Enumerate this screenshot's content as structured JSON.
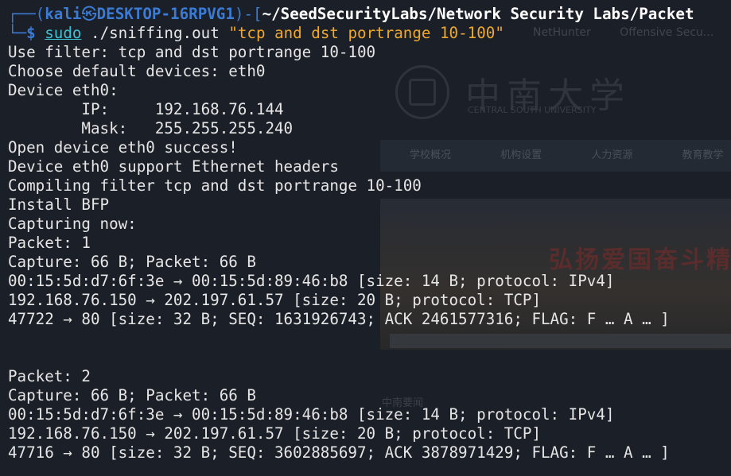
{
  "background": {
    "tabs": [
      "NetHunter",
      "Offensive Secu..."
    ],
    "site_title": "中南大学",
    "site_subtitle": "CENTRAL SOUTH UNIVERSITY",
    "nav": [
      "学校概况",
      "机构设置",
      "人力资源",
      "教育教学"
    ],
    "slogan": "弘扬爱国奋斗精",
    "news": "中南要闻"
  },
  "prompt": {
    "open": "┌──(",
    "user": "kali",
    "at": "㉿",
    "host": "DESKTOP-16RPVG1",
    "mid": ")-[",
    "path": "~/SeedSecurityLabs/Network Security Labs/Packet",
    "close": "",
    "tail": "└─",
    "dollar": "$",
    "sudo": "sudo",
    "exec": "./sniffing.out",
    "arg": "\"tcp and dst portrange 10-100\""
  },
  "output": [
    "Use filter: tcp and dst portrange 10-100",
    "Choose default devices: eth0",
    "Device eth0:",
    "        IP:     192.168.76.144",
    "        Mask:   255.255.255.240",
    "Open device eth0 success!",
    "Device eth0 support Ethernet headers",
    "Compiling filter tcp and dst portrange 10-100",
    "Install BFP",
    "Capturing now:",
    "Packet: 1",
    "Capture: 66 B; Packet: 66 B",
    "00:15:5d:d7:6f:3e → 00:15:5d:89:46:b8 [size: 14 B; protocol: IPv4]",
    "192.168.76.150 → 202.197.61.57 [size: 20 B; protocol: TCP]",
    "47722 → 80 [size: 32 B; SEQ: 1631926743; ACK 2461577316; FLAG: F … A … ]",
    "",
    "",
    "Packet: 2",
    "Capture: 66 B; Packet: 66 B",
    "00:15:5d:d7:6f:3e → 00:15:5d:89:46:b8 [size: 14 B; protocol: IPv4]",
    "192.168.76.150 → 202.197.61.57 [size: 20 B; protocol: TCP]",
    "47716 → 80 [size: 32 B; SEQ: 3602885697; ACK 3878971429; FLAG: F … A … ]"
  ]
}
